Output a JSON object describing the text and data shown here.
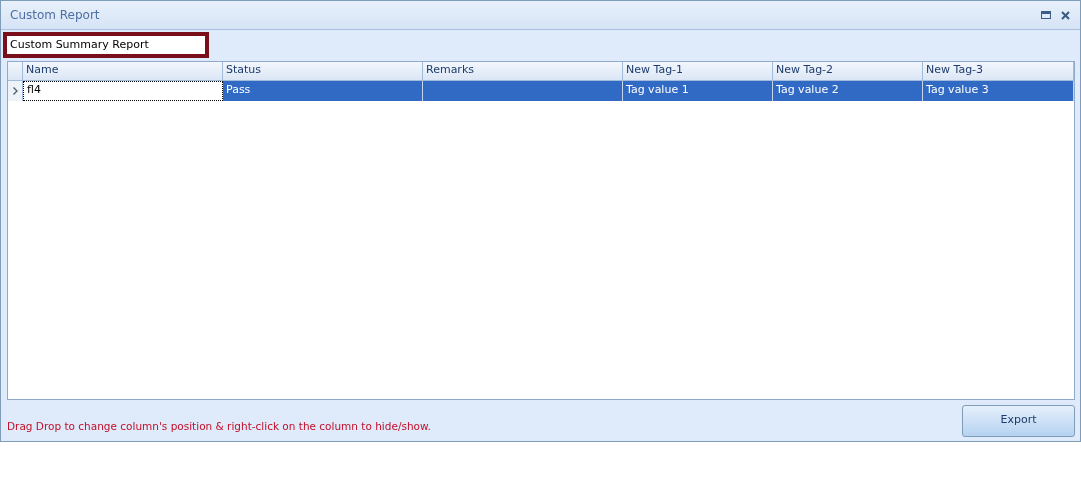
{
  "window": {
    "title": "Custom Report"
  },
  "report_name": {
    "value": "Custom Summary Report"
  },
  "table": {
    "columns": [
      "Name",
      "Status",
      "Remarks",
      "New Tag-1",
      "New Tag-2",
      "New Tag-3"
    ],
    "rows": [
      {
        "selected": true,
        "cells": [
          "fl4",
          "Pass",
          "",
          "Tag value 1",
          "Tag value 2",
          "Tag value 3"
        ]
      }
    ]
  },
  "hint": "Drag Drop to change column's position & right-click on the column to hide/show.",
  "buttons": [
    "Export"
  ]
}
